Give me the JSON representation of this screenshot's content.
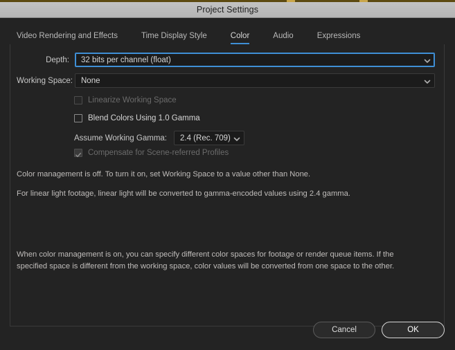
{
  "window": {
    "title": "Project Settings"
  },
  "tabs": [
    {
      "label": "Video Rendering and Effects",
      "active": false
    },
    {
      "label": "Time Display Style",
      "active": false
    },
    {
      "label": "Color",
      "active": true
    },
    {
      "label": "Audio",
      "active": false
    },
    {
      "label": "Expressions",
      "active": false
    }
  ],
  "fields": {
    "depth": {
      "label": "Depth:",
      "value": "32 bits per channel (float)",
      "focused": true
    },
    "working_space": {
      "label": "Working Space:",
      "value": "None",
      "focused": false
    },
    "assume_working_gamma": {
      "label": "Assume Working Gamma:",
      "value": "2.4 (Rec. 709)",
      "focused": false
    }
  },
  "checkboxes": [
    {
      "label": "Linearize Working Space",
      "checked": false,
      "disabled": true
    },
    {
      "label": "Blend Colors Using 1.0 Gamma",
      "checked": false,
      "disabled": false
    },
    {
      "label": "Compensate for Scene-referred Profiles",
      "checked": true,
      "disabled": true
    }
  ],
  "descriptions": {
    "line1": "Color management is off. To turn it on, set Working Space to a value other than None.",
    "line2": "For linear light footage, linear light will be converted to gamma-encoded values using 2.4 gamma.",
    "line3": "When color management is on, you can specify different color spaces for footage or render queue items. If the specified space is different from the working space, color values will be converted from one space to the other."
  },
  "footer": {
    "cancel_label": "Cancel",
    "ok_label": "OK"
  },
  "icons": {
    "chevron_down": "chevron-down-icon",
    "check": "check-icon"
  },
  "colors": {
    "accent": "#3f8fd6",
    "titlebar": "#b9b9b9",
    "dialog_bg": "#232323",
    "field_bg": "#1b1b1b",
    "timeline_blue": "#3e4670"
  }
}
